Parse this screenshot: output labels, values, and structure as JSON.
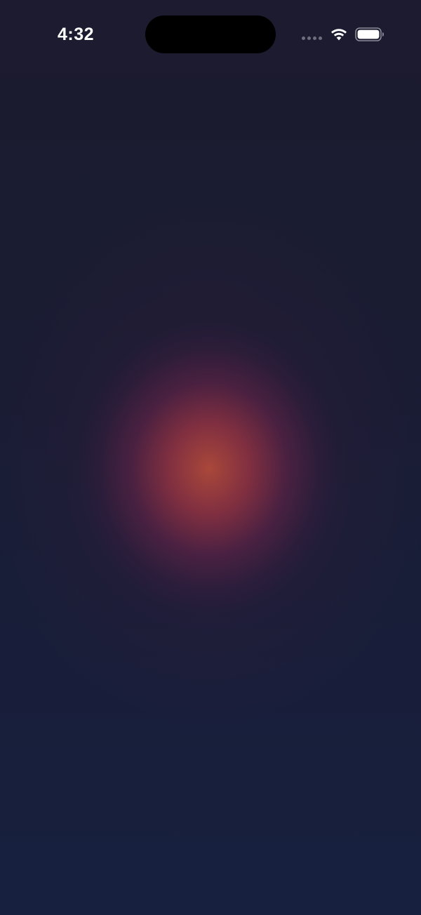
{
  "status_bar": {
    "time": "4:32",
    "cellular_icon": "signal-dots-icon",
    "wifi_icon": "wifi-icon",
    "battery_icon": "battery-icon"
  },
  "colors": {
    "background_top": "#1c1b2f",
    "background_bottom": "#17203f",
    "glow_center": "#b04a3a",
    "glow_mid": "#682448",
    "text": "#ffffff"
  }
}
